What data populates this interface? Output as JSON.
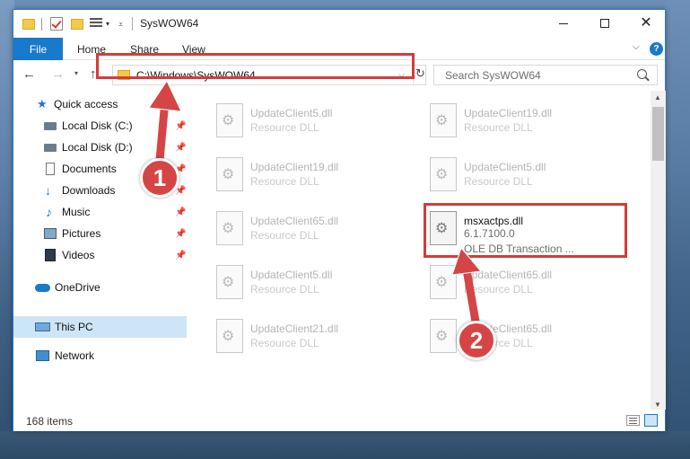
{
  "window": {
    "title": "SysWOW64"
  },
  "ribbon": {
    "tabs": [
      "File",
      "Home",
      "Share",
      "View"
    ]
  },
  "address": {
    "path": "C:\\Windows\\SysWOW64"
  },
  "search": {
    "placeholder": "Search SysWOW64"
  },
  "nav": {
    "items": [
      {
        "label": "Quick access",
        "icon": "star-icon",
        "pinned": false
      },
      {
        "label": "Local Disk (C:)",
        "icon": "disk-icon",
        "pinned": true
      },
      {
        "label": "Local Disk (D:)",
        "icon": "disk-icon",
        "pinned": true
      },
      {
        "label": "Documents",
        "icon": "documents-icon",
        "pinned": true
      },
      {
        "label": "Downloads",
        "icon": "download-icon",
        "pinned": true
      },
      {
        "label": "Music",
        "icon": "music-icon",
        "pinned": true
      },
      {
        "label": "Pictures",
        "icon": "pictures-icon",
        "pinned": true
      },
      {
        "label": "Videos",
        "icon": "videos-icon",
        "pinned": true
      },
      {
        "label": "OneDrive",
        "icon": "onedrive-icon",
        "pinned": false
      },
      {
        "label": "This PC",
        "icon": "pc-icon",
        "pinned": false,
        "selected": true
      },
      {
        "label": "Network",
        "icon": "network-icon",
        "pinned": false
      }
    ]
  },
  "files": {
    "left": [
      {
        "name": "UpdateClient5.dll",
        "desc": "Resource DLL"
      },
      {
        "name": "UpdateClient19.dll",
        "desc": "Resource DLL"
      },
      {
        "name": "UpdateClient65.dll",
        "desc": "Resource DLL"
      },
      {
        "name": "UpdateClient5.dll",
        "desc": "Resource DLL"
      },
      {
        "name": "UpdateClient21.dll",
        "desc": "Resource DLL"
      }
    ],
    "right": [
      {
        "name": "UpdateClient19.dll",
        "desc": "Resource DLL"
      },
      {
        "name": "UpdateClient5.dll",
        "desc": "Resource DLL"
      },
      {
        "name": "UpdateClient65.dll",
        "desc": "Resource DLL"
      },
      {
        "name": "UpdateClient65.dll",
        "desc": "Resource DLL"
      }
    ],
    "highlighted": {
      "name": "msxactps.dll",
      "version": "6.1.7100.0",
      "desc": "OLE DB Transaction ..."
    }
  },
  "status": {
    "count": "168 items"
  },
  "annotations": {
    "step1": "1",
    "step2": "2"
  },
  "colors": {
    "accent": "#1979ca",
    "highlight": "#d63b3b",
    "selected": "#cde6f7"
  }
}
